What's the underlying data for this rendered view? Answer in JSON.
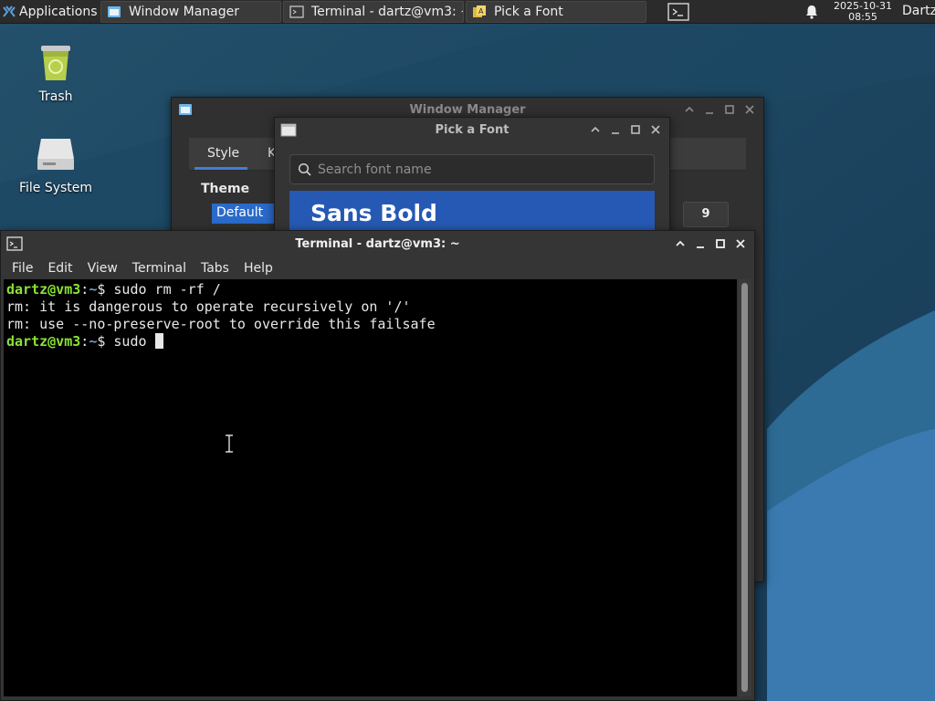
{
  "panel": {
    "applications_label": "Applications",
    "tasks": [
      {
        "label": "Window Manager"
      },
      {
        "label": "Terminal - dartz@vm3: ~"
      },
      {
        "label": "Pick a Font"
      }
    ],
    "clock_date": "2025-10-31",
    "clock_time": "08:55",
    "user": "Dartz"
  },
  "desktop": {
    "icons": [
      {
        "label": "Trash",
        "icon": "trash-icon"
      },
      {
        "label": "File System",
        "icon": "drive-icon"
      }
    ]
  },
  "window_manager": {
    "title": "Window Manager",
    "tab_style": "Style",
    "tab_k": "K",
    "theme_label": "Theme",
    "theme_selected": "Default",
    "spin_value": "9"
  },
  "font_picker": {
    "title": "Pick a Font",
    "search_placeholder": "Search font name",
    "preview_text": "Sans Bold"
  },
  "terminal": {
    "title": "Terminal - dartz@vm3: ~",
    "menu": [
      "File",
      "Edit",
      "View",
      "Terminal",
      "Tabs",
      "Help"
    ],
    "lines": [
      {
        "user": "dartz@vm3",
        "sep": ":",
        "path": "~",
        "prompt": "$",
        "command": " sudo rm -rf /"
      },
      {
        "text": "rm: it is dangerous to operate recursively on '/'"
      },
      {
        "text": "rm: use --no-preserve-root to override this failsafe"
      },
      {
        "user": "dartz@vm3",
        "sep": ":",
        "path": "~",
        "prompt": "$",
        "command": " sudo "
      }
    ]
  },
  "colors": {
    "prompt_user": "#8ae234",
    "prompt_path": "#729fcf",
    "selection": "#2a6ac9"
  }
}
